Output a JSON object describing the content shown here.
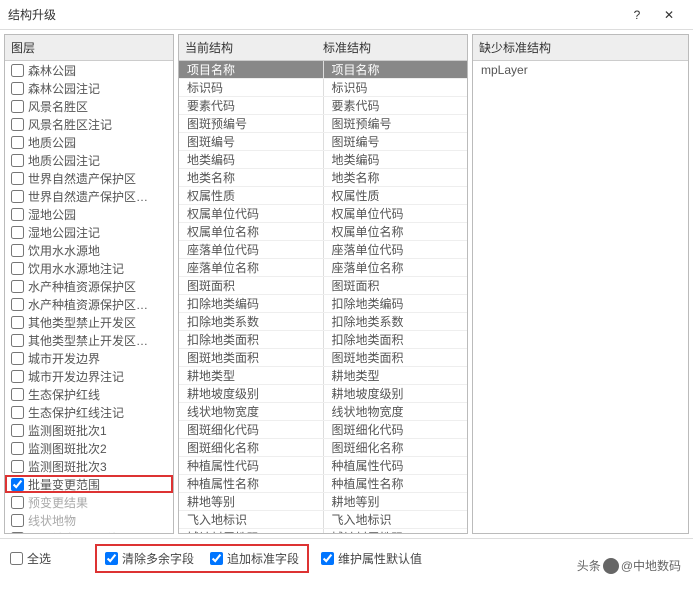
{
  "window": {
    "title": "结构升级",
    "help": "?",
    "close": "✕"
  },
  "layers": {
    "header": "图层",
    "items": [
      {
        "label": "森林公园",
        "checked": false
      },
      {
        "label": "森林公园注记",
        "checked": false
      },
      {
        "label": "风景名胜区",
        "checked": false
      },
      {
        "label": "风景名胜区注记",
        "checked": false
      },
      {
        "label": "地质公园",
        "checked": false
      },
      {
        "label": "地质公园注记",
        "checked": false
      },
      {
        "label": "世界自然遗产保护区",
        "checked": false
      },
      {
        "label": "世界自然遗产保护区…",
        "checked": false
      },
      {
        "label": "湿地公园",
        "checked": false
      },
      {
        "label": "湿地公园注记",
        "checked": false
      },
      {
        "label": "饮用水水源地",
        "checked": false
      },
      {
        "label": "饮用水水源地注记",
        "checked": false
      },
      {
        "label": "水产种植资源保护区",
        "checked": false
      },
      {
        "label": "水产种植资源保护区…",
        "checked": false
      },
      {
        "label": "其他类型禁止开发区",
        "checked": false
      },
      {
        "label": "其他类型禁止开发区…",
        "checked": false
      },
      {
        "label": "城市开发边界",
        "checked": false
      },
      {
        "label": "城市开发边界注记",
        "checked": false
      },
      {
        "label": "生态保护红线",
        "checked": false
      },
      {
        "label": "生态保护红线注记",
        "checked": false
      },
      {
        "label": "监测图斑批次1",
        "checked": false
      },
      {
        "label": "监测图斑批次2",
        "checked": false
      },
      {
        "label": "监测图斑批次3",
        "checked": false
      },
      {
        "label": "批量变更范围",
        "checked": true,
        "highlight": true
      },
      {
        "label": "预变更结果",
        "checked": false,
        "muted": true
      },
      {
        "label": "线状地物",
        "checked": false,
        "muted": true
      },
      {
        "label": "分乡镇变更_界线",
        "checked": false,
        "muted": true
      }
    ]
  },
  "struct": {
    "header_left": "当前结构",
    "header_right": "标准结构",
    "rows": [
      {
        "l": "项目名称",
        "r": "项目名称",
        "header": true
      },
      {
        "l": "标识码",
        "r": "标识码"
      },
      {
        "l": "要素代码",
        "r": "要素代码"
      },
      {
        "l": "图斑预编号",
        "r": "图斑预编号"
      },
      {
        "l": "图斑编号",
        "r": "图斑编号"
      },
      {
        "l": "地类编码",
        "r": "地类编码"
      },
      {
        "l": "地类名称",
        "r": "地类名称"
      },
      {
        "l": "权属性质",
        "r": "权属性质"
      },
      {
        "l": "权属单位代码",
        "r": "权属单位代码"
      },
      {
        "l": "权属单位名称",
        "r": "权属单位名称"
      },
      {
        "l": "座落单位代码",
        "r": "座落单位代码"
      },
      {
        "l": "座落单位名称",
        "r": "座落单位名称"
      },
      {
        "l": "图斑面积",
        "r": "图斑面积"
      },
      {
        "l": "扣除地类编码",
        "r": "扣除地类编码"
      },
      {
        "l": "扣除地类系数",
        "r": "扣除地类系数"
      },
      {
        "l": "扣除地类面积",
        "r": "扣除地类面积"
      },
      {
        "l": "图斑地类面积",
        "r": "图斑地类面积"
      },
      {
        "l": "耕地类型",
        "r": "耕地类型"
      },
      {
        "l": "耕地坡度级别",
        "r": "耕地坡度级别"
      },
      {
        "l": "线状地物宽度",
        "r": "线状地物宽度"
      },
      {
        "l": "图斑细化代码",
        "r": "图斑细化代码"
      },
      {
        "l": "图斑细化名称",
        "r": "图斑细化名称"
      },
      {
        "l": "种植属性代码",
        "r": "种植属性代码"
      },
      {
        "l": "种植属性名称",
        "r": "种植属性名称"
      },
      {
        "l": "耕地等别",
        "r": "耕地等别"
      },
      {
        "l": "飞入地标识",
        "r": "飞入地标识"
      },
      {
        "l": "城镇村属性码",
        "r": "城镇村属性码"
      }
    ]
  },
  "missing": {
    "header": "缺少标准结构",
    "items": [
      "mpLayer"
    ]
  },
  "footer": {
    "select_all": "全选",
    "clear_fields": "清除多余字段",
    "add_fields": "追加标准字段",
    "maintain_defaults": "维护属性默认值"
  },
  "attribution": {
    "prefix": "头条",
    "name": "@中地数码"
  }
}
